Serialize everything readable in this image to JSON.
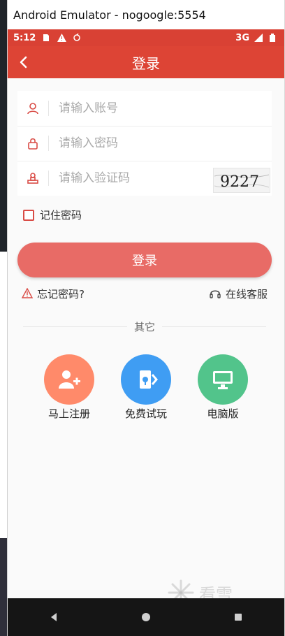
{
  "window": {
    "title": "Android Emulator - nogoogle:5554"
  },
  "status_bar": {
    "time": "5:12",
    "network": "3G"
  },
  "app_bar": {
    "title": "登录"
  },
  "form": {
    "account_placeholder": "请输入账号",
    "password_placeholder": "请输入密码",
    "captcha_placeholder": "请输入验证码",
    "captcha_value": "9227"
  },
  "remember_label": "记住密码",
  "login_button": "登录",
  "links": {
    "forgot": "忘记密码?",
    "support": "在线客服"
  },
  "divider_label": "其它",
  "others": [
    {
      "label": "马上注册",
      "icon": "register-icon",
      "color": "#ff8a6a"
    },
    {
      "label": "免费试玩",
      "icon": "trial-icon",
      "color": "#3f9df3"
    },
    {
      "label": "电脑版",
      "icon": "desktop-icon",
      "color": "#52c48b"
    }
  ],
  "watermark": {
    "text": "看雪"
  },
  "colors": {
    "primary": "#dd4435",
    "button": "#e86b66",
    "accent_icon": "#d94b45"
  }
}
